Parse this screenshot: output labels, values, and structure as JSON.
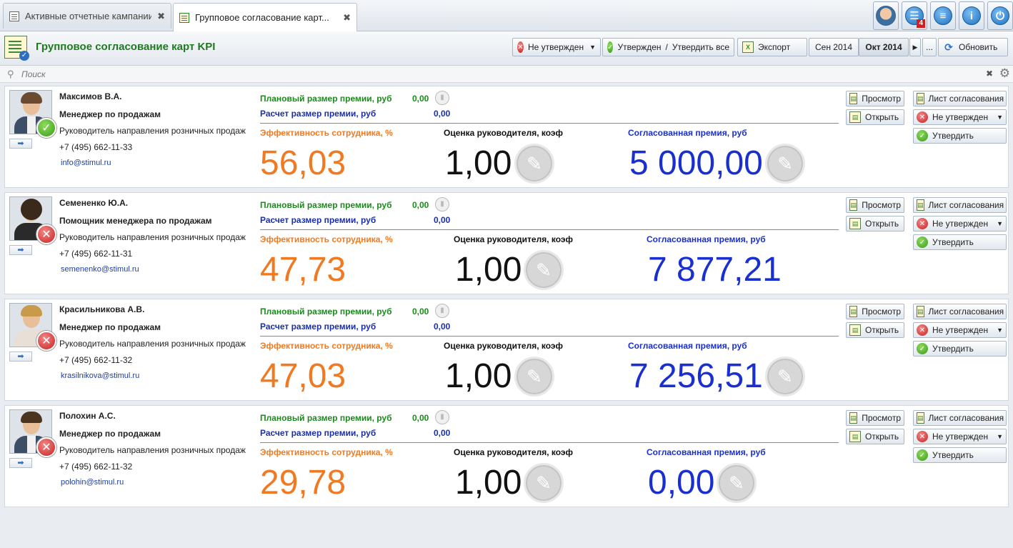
{
  "tabs": [
    {
      "label": "Активные отчетные кампании"
    },
    {
      "label": "Групповое согласование карт..."
    }
  ],
  "header": {
    "title": "Групповое согласование карт KPI",
    "filter_status": "Не утвержден",
    "approved": "Утвержден",
    "approve_all": "Утвердить все",
    "export": "Экспорт",
    "month_prev": "Сен 2014",
    "month_current": "Окт 2014",
    "more": "...",
    "refresh": "Обновить"
  },
  "notifications_badge": "4",
  "search": {
    "placeholder": "Поиск"
  },
  "labels": {
    "plan": "Плановый размер премии, руб",
    "calc": "Расчет размер премии, руб",
    "eff": "Эффективность сотрудника, %",
    "mgr": "Оценка руководителя, коэф",
    "bonus": "Согласованная премия, руб",
    "view": "Просмотр",
    "open": "Открыть",
    "sheet": "Лист согласования",
    "not_approved": "Не утвержден",
    "approve": "Утвердить"
  },
  "employees": [
    {
      "name": "Максимов В.А.",
      "position": "Менеджер по продажам",
      "department": "Руководитель направления розничных продаж",
      "phone": "+7 (495) 662-11-33",
      "email": "info@stimul.ru",
      "plan": "0,00",
      "calc": "0,00",
      "eff": "56,03",
      "mgr": "1,00",
      "bonus": "5 000,00",
      "status": "approved"
    },
    {
      "name": "Семененко Ю.А.",
      "position": "Помощник менеджера по продажам",
      "department": "Руководитель направления розничных продаж",
      "phone": "+7 (495) 662-11-31",
      "email": "semenenko@stimul.ru",
      "plan": "0,00",
      "calc": "0,00",
      "eff": "47,73",
      "mgr": "1,00",
      "bonus": "7 877,21",
      "status": "not_approved"
    },
    {
      "name": "Красильникова А.В.",
      "position": "Менеджер по продажам",
      "department": "Руководитель направления розничных продаж",
      "phone": "+7 (495) 662-11-32",
      "email": "krasilnikova@stimul.ru",
      "plan": "0,00",
      "calc": "0,00",
      "eff": "47,03",
      "mgr": "1,00",
      "bonus": "7 256,51",
      "status": "not_approved"
    },
    {
      "name": "Полохин А.С.",
      "position": "Менеджер по продажам",
      "department": "Руководитель направления розничных продаж",
      "phone": "+7 (495) 662-11-32",
      "email": "polohin@stimul.ru",
      "plan": "0,00",
      "calc": "0,00",
      "eff": "29,78",
      "mgr": "1,00",
      "bonus": "0,00",
      "status": "not_approved"
    }
  ],
  "colors": {
    "plan": "#1c8a1c",
    "calc": "#1a2fa8",
    "eff": "#f07a22",
    "bonus": "#1a2fd0",
    "title": "#1e7a1e"
  }
}
